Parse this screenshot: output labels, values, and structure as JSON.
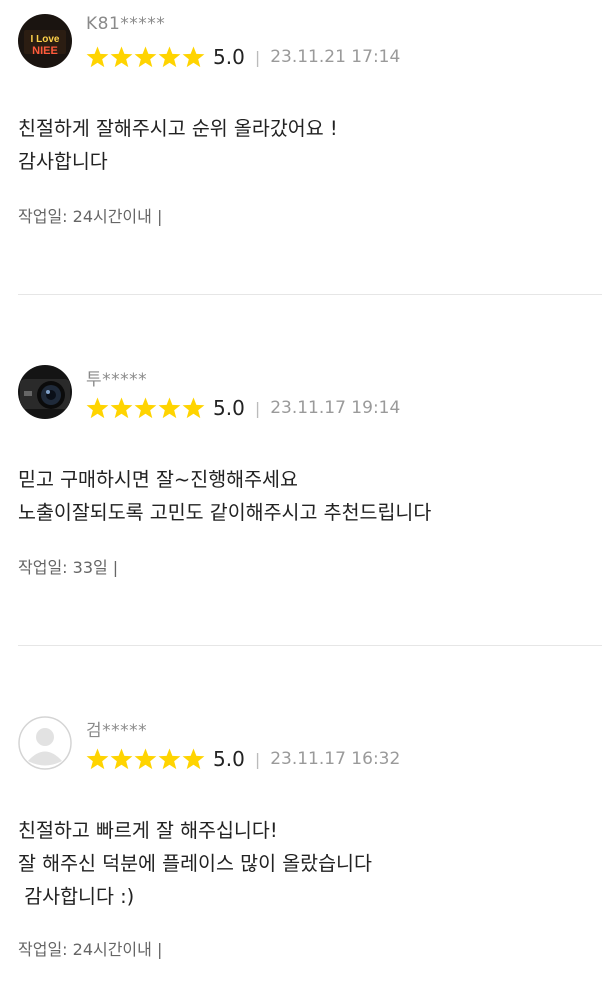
{
  "colors": {
    "star": "#FFD400",
    "divider": "#e6e6e6"
  },
  "reviews": [
    {
      "avatar_icon": "i-love-neon-sign-avatar",
      "name": "K81*****",
      "score": "5.0",
      "date": "23.11.21 17:14",
      "lines": [
        "친절하게 잘해주시고 순위 올라갔어요 !",
        "감사합니다"
      ],
      "meta": "작업일: 24시간이내 |"
    },
    {
      "avatar_icon": "camera-avatar",
      "name": "투*****",
      "score": "5.0",
      "date": "23.11.17 19:14",
      "lines": [
        "믿고 구매하시면 잘~진행해주세요",
        "노출이잘되도록 고민도 같이해주시고 추천드립니다"
      ],
      "meta": "작업일: 33일 |"
    },
    {
      "avatar_icon": "default-user-avatar",
      "name": "검*****",
      "score": "5.0",
      "date": "23.11.17 16:32",
      "lines": [
        "친절하고 빠르게 잘 해주십니다!",
        "잘 해주신 덕분에 플레이스 많이 올랐습니다",
        " 감사합니다 :)"
      ],
      "meta": "작업일: 24시간이내 |"
    }
  ],
  "avatar_text": {
    "line1": "I Love",
    "line2": "NIEE"
  }
}
